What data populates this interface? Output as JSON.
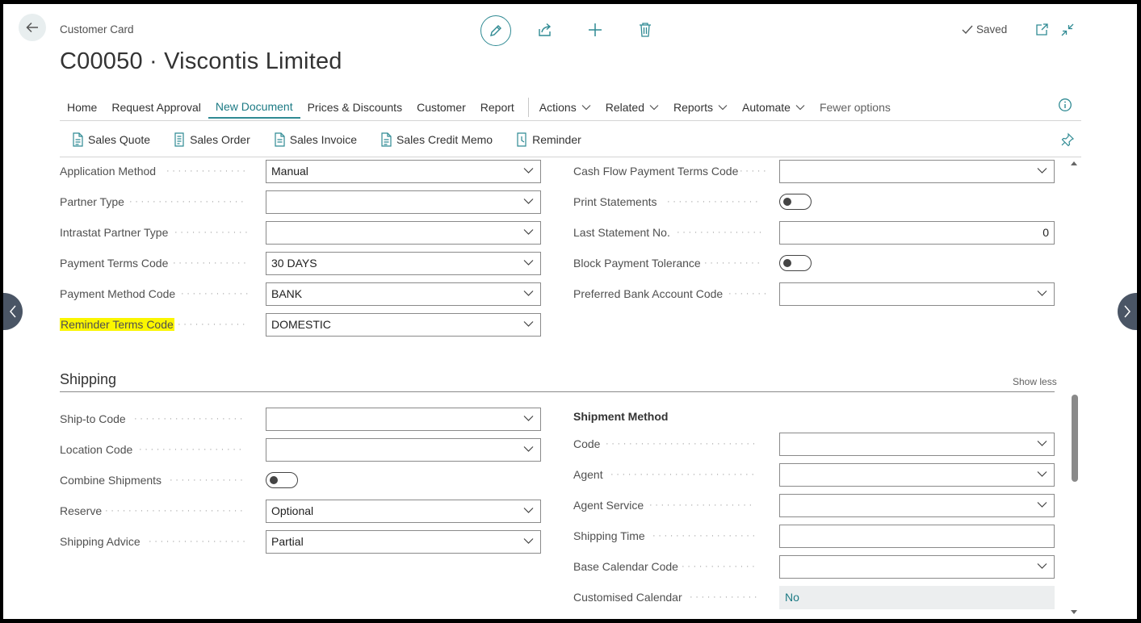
{
  "header": {
    "caption": "Customer Card",
    "title": "C00050 · Viscontis Limited",
    "saved_label": "Saved"
  },
  "actions": {
    "items": [
      {
        "label": "Home"
      },
      {
        "label": "Request Approval"
      },
      {
        "label": "New Document",
        "active": true
      },
      {
        "label": "Prices & Discounts"
      },
      {
        "label": "Customer"
      },
      {
        "label": "Report"
      }
    ],
    "menus": [
      {
        "label": "Actions"
      },
      {
        "label": "Related"
      },
      {
        "label": "Reports"
      },
      {
        "label": "Automate"
      }
    ],
    "fewer_options": "Fewer options"
  },
  "new_document": {
    "items": [
      {
        "label": "Sales Quote"
      },
      {
        "label": "Sales Order"
      },
      {
        "label": "Sales Invoice"
      },
      {
        "label": "Sales Credit Memo"
      },
      {
        "label": "Reminder"
      }
    ]
  },
  "payments": {
    "left": [
      {
        "label": "Application Method",
        "value": "Manual"
      },
      {
        "label": "Partner Type",
        "value": ""
      },
      {
        "label": "Intrastat Partner Type",
        "value": ""
      },
      {
        "label": "Payment Terms Code",
        "value": "30 DAYS"
      },
      {
        "label": "Payment Method Code",
        "value": "BANK"
      },
      {
        "label": "Reminder Terms Code",
        "value": "DOMESTIC"
      }
    ],
    "right": {
      "cash_flow_label": "Cash Flow Payment Terms Code",
      "cash_flow_value": "",
      "print_statements_label": "Print Statements",
      "last_statement_label": "Last Statement No.",
      "last_statement_value": "0",
      "block_tolerance_label": "Block Payment Tolerance",
      "preferred_bank_label": "Preferred Bank Account Code",
      "preferred_bank_value": ""
    }
  },
  "shipping": {
    "title": "Shipping",
    "show_less": "Show less",
    "ship_to_label": "Ship-to Code",
    "ship_to_value": "",
    "location_label": "Location Code",
    "location_value": "",
    "combine_label": "Combine Shipments",
    "reserve_label": "Reserve",
    "reserve_value": "Optional",
    "advice_label": "Shipping Advice",
    "advice_value": "Partial",
    "method_title": "Shipment Method",
    "code_label": "Code",
    "code_value": "",
    "agent_label": "Agent",
    "agent_value": "",
    "agent_service_label": "Agent Service",
    "agent_service_value": "",
    "time_label": "Shipping Time",
    "time_value": "",
    "base_cal_label": "Base Calendar Code",
    "base_cal_value": "",
    "custom_cal_label": "Customised Calendar",
    "custom_cal_value": "No"
  },
  "colors": {
    "accent": "#2f8a93",
    "highlight": "#fbf600",
    "nav_arrow": "#4a5565"
  }
}
